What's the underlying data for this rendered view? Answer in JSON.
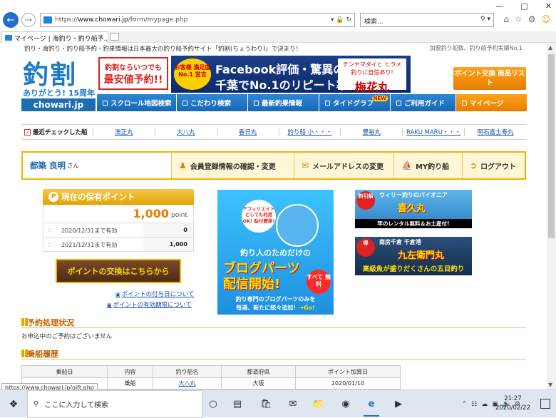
{
  "browser": {
    "window_controls": [
      "—",
      "□",
      "✕"
    ],
    "address": {
      "scheme": "https://",
      "host": "www.chowari.jp",
      "path": "/form/mypage.php"
    },
    "search_placeholder": "検索...",
    "tab_title": "マイページ | 海釣り・釣り船予...",
    "status_url": "https://www.chowari.jp/gift.php"
  },
  "header": {
    "tagline": "釣り・海釣り・釣り船予約・釣果情報は日本最大の釣り船予約サイト「釣割(ちょうわり)」で決まり！",
    "tagline_right": "加盟釣り船数、釣り船予約実績No.1",
    "logo_kanji": "釣割",
    "logo_thanks": "ありがとう! 15周年",
    "logo_domain": "chowari.jp",
    "promo_left_top": "釣割ならいつでも",
    "promo_left_main": "最安値予約!!",
    "promo_badge": "お客様 満足度No.1 宣言",
    "promo_line1": "Facebook評価・驚異の4.9!",
    "promo_line2": "千葉でNo.1のリピート率",
    "promo_side_top": "テンヤマダイと ヒラメ釣りに自信あり!",
    "promo_side_name": "梅花丸",
    "point_button": "ポイント交換 商品リスト"
  },
  "gnav": [
    {
      "label": "スクロール地図検索",
      "new": false
    },
    {
      "label": "こだわり検索",
      "new": false
    },
    {
      "label": "最新釣果情報",
      "new": false
    },
    {
      "label": "タイドグラフ",
      "new": true,
      "new_label": "NEW"
    },
    {
      "label": "ご利用ガイド",
      "new": false
    },
    {
      "label": "マイページ",
      "new": false
    }
  ],
  "recent": {
    "label": "最近チェックした船",
    "items": [
      "漁正丸",
      "大八丸",
      "春日丸",
      "釣り船 小・・・",
      "豊裕丸",
      "RAKU MARU・・・",
      "明石富士寿丸"
    ]
  },
  "user": {
    "name": "都築 良明",
    "suffix": "さん",
    "buttons": [
      {
        "label": "会員登録情報の確認・変更"
      },
      {
        "label": "メールアドレスの変更"
      },
      {
        "label": "MY釣り船"
      },
      {
        "label": "ログアウト"
      }
    ]
  },
  "points": {
    "title": "現在の保有ポイント",
    "total": "1,000",
    "unit": "point",
    "rows": [
      {
        "date": "2020/12/31まで有効",
        "value": "0"
      },
      {
        "date": "2021/12/31まで有効",
        "value": "1,000"
      }
    ],
    "exchange_banner": "ポイントの交換はこちらから",
    "link1": "ポイントの付与日について",
    "link2": "ポイントの有効期限について"
  },
  "big_banner": {
    "affiliate": "アフィリエイト としても利用OK! 貼付簡単!",
    "line1": "釣り人のためだけの",
    "line2": "ブログパーツ",
    "line3": "配信開始!",
    "free": "すべて 無料",
    "line4": "釣り専門のブログパーツのみを",
    "line5": "毎週、新たに続々追加！",
    "go": "→Go!"
  },
  "right_banners": [
    {
      "tag": "釣引船",
      "top": "ウィリー釣りのパイオニア",
      "name": "喜久丸",
      "bottom": "竿のレンタル無料＆お土産付!"
    },
    {
      "tag": "得",
      "top": "南房千倉 千倉港",
      "name": "九左衛門丸",
      "bottom": "高級魚が盛りだくさんの五目釣り"
    }
  ],
  "reservation": {
    "title": "予約処理状況",
    "empty": "お申込中のご予約はございません"
  },
  "history": {
    "title": "乗船履歴",
    "headers": [
      "乗船日",
      "内容",
      "釣り船名",
      "都道府県",
      "ポイント加算日"
    ],
    "rows": [
      [
        "",
        "乗船",
        "大八丸",
        "大阪",
        "2020/01/10"
      ]
    ]
  },
  "taskbar": {
    "search_placeholder": "ここに入力して検索",
    "time": "21:27",
    "date": "2020/02/22"
  }
}
